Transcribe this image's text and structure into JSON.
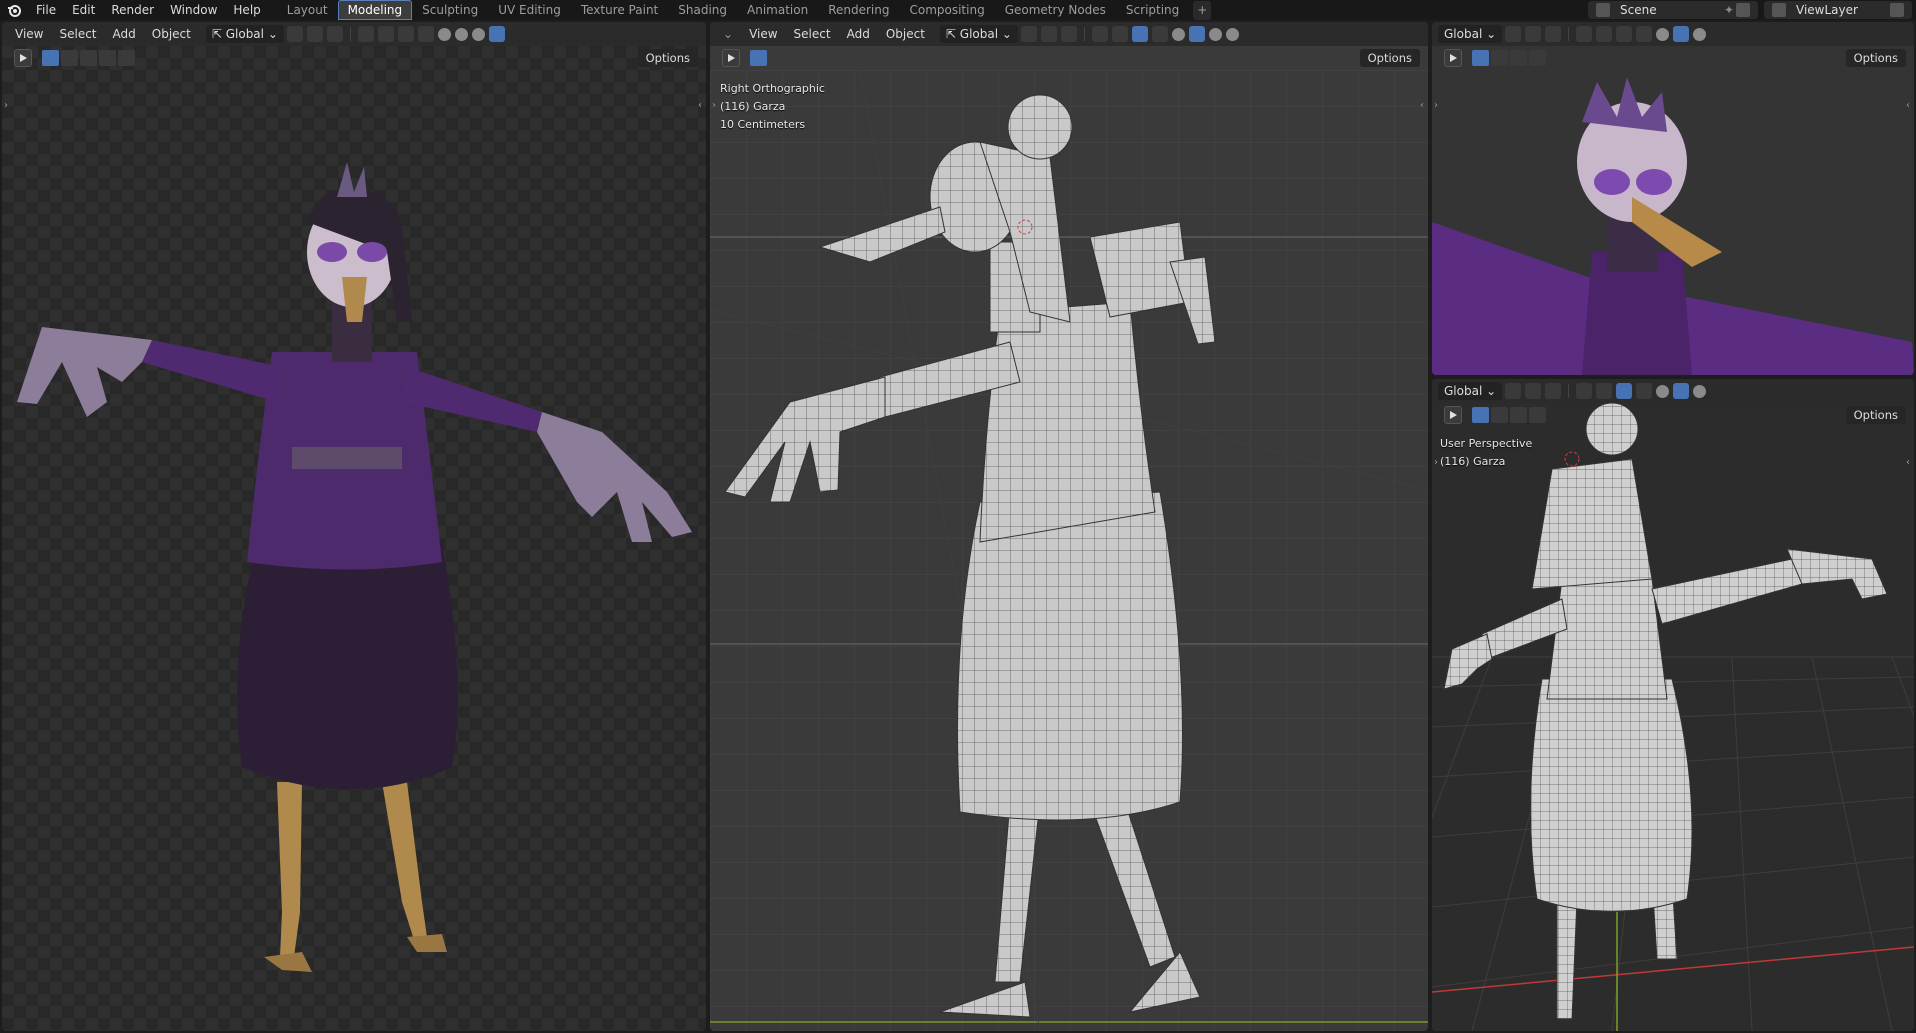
{
  "menus": [
    "File",
    "Edit",
    "Render",
    "Window",
    "Help"
  ],
  "workspaces": [
    "Layout",
    "Modeling",
    "Sculpting",
    "UV Editing",
    "Texture Paint",
    "Shading",
    "Animation",
    "Rendering",
    "Compositing",
    "Geometry Nodes",
    "Scripting"
  ],
  "active_workspace": "Modeling",
  "add_tab": "+",
  "scene": "Scene",
  "view_layer": "ViewLayer",
  "viewport_header": {
    "view": "View",
    "select": "Select",
    "add": "Add",
    "object": "Object",
    "orientation": "Global",
    "options": "Options"
  },
  "viewport_left": {
    "shading": "material-preview"
  },
  "viewport_center": {
    "view_name": "Right Orthographic",
    "object_info": "(116) Garza",
    "scale": "10 Centimeters"
  },
  "viewport_top_right": {
    "shading": "material-preview"
  },
  "viewport_bottom_right": {
    "view_name": "User Perspective",
    "object_info": "(116) Garza"
  },
  "colors": {
    "accent": "#4772b3",
    "active_tab_border": "#5a7fbf",
    "bg": "#1d1d1d",
    "area": "#2e2e2e",
    "header": "#2b2b2b",
    "costume_purple": "#4d2a6c",
    "beak": "#b08a4c"
  },
  "icons": [
    "blender-logo",
    "transform-icon",
    "snap-icon",
    "proportional-icon",
    "visibility-icon",
    "gizmo-icon",
    "overlay-icon",
    "xray-icon",
    "wireframe-shading-icon",
    "solid-shading-icon",
    "material-shading-icon",
    "rendered-shading-icon",
    "scene-icon",
    "pin-icon",
    "new-scene-icon",
    "viewlayer-icon",
    "tool-icon"
  ]
}
